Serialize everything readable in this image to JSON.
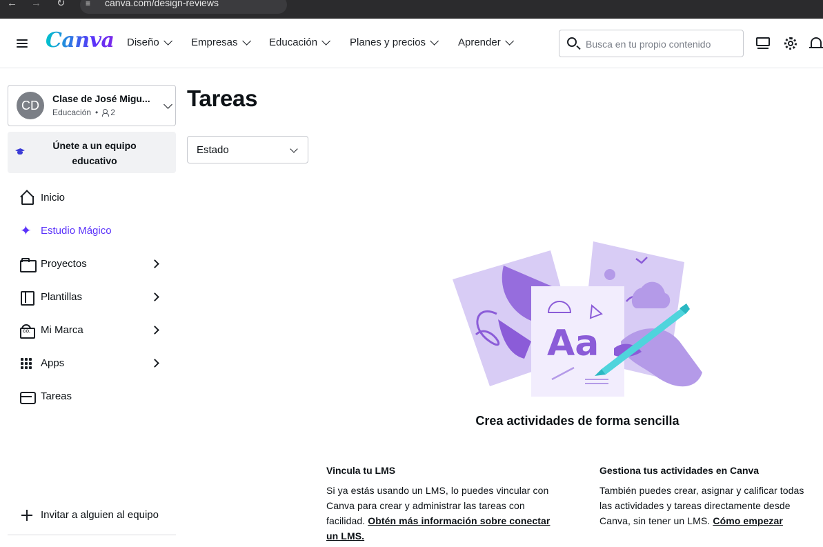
{
  "browser": {
    "url": "canva.com/design-reviews"
  },
  "header": {
    "logo": "Canva",
    "nav": [
      {
        "label": "Diseño"
      },
      {
        "label": "Empresas"
      },
      {
        "label": "Educación"
      },
      {
        "label": "Planes y precios"
      },
      {
        "label": "Aprender"
      }
    ],
    "search_placeholder": "Busca en tu propio contenido"
  },
  "sidebar": {
    "team": {
      "initials": "CD",
      "name": "Clase de José Migu...",
      "type": "Educación",
      "members": "2"
    },
    "join_button": "Únete a un equipo educativo",
    "items": [
      {
        "label": "Inicio"
      },
      {
        "label": "Estudio Mágico"
      },
      {
        "label": "Proyectos"
      },
      {
        "label": "Plantillas"
      },
      {
        "label": "Mi Marca"
      },
      {
        "label": "Apps"
      },
      {
        "label": "Tareas"
      }
    ],
    "invite": "Invitar a alguien al equipo"
  },
  "main": {
    "title": "Tareas",
    "status_filter": "Estado",
    "empty_title": "Crea actividades de forma sencilla",
    "lms": {
      "heading": "Vincula tu LMS",
      "text": "Si ya estás usando un LMS, lo puedes vincular con Canva para crear y administrar las tareas con facilidad. ",
      "link": "Obtén más información sobre conectar un LMS."
    },
    "manage": {
      "heading": "Gestiona tus actividades en Canva",
      "text": "También puedes crear, asignar y calificar todas las actividades y tareas directamente desde Canva, sin tener un LMS. ",
      "link": "Cómo empezar"
    },
    "illustration_text": "Aa"
  },
  "colors": {
    "brand_purple": "#5a32fa",
    "brand_teal": "#00c4cc",
    "illus_lavender": "#d8ccf5",
    "illus_purple": "#8b5cd8"
  }
}
